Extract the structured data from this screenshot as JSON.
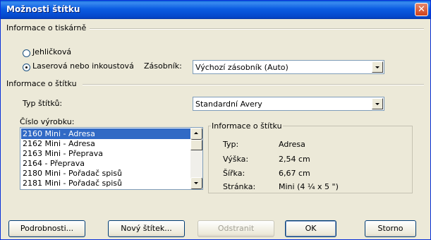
{
  "window": {
    "title": "Možnosti štítku",
    "close_icon": "close-icon"
  },
  "printer_group": {
    "label": "Informace o tiskárně",
    "radio_dotmatrix": "Jehličková",
    "radio_laser": "Laserová nebo inkoustová",
    "selected": "laser",
    "tray_label": "Zásobník:",
    "tray_value": "Výchozí zásobník (Auto)"
  },
  "label_group": {
    "label": "Informace o štítku",
    "type_label": "Typ štítků:",
    "type_value": "Standardní Avery",
    "product_label": "Číslo výrobku:",
    "products": [
      "2160 Mini - Adresa",
      "2162 Mini - Adresa",
      "2163 Mini - Přeprava",
      "2164 - Přeprava",
      "2180 Mini - Pořadač spisů",
      "2181 Mini - Pořadač spisů"
    ],
    "selected_index": 0
  },
  "info": {
    "title": "Informace o štítku",
    "rows": [
      {
        "label": "Typ:",
        "value": "Adresa"
      },
      {
        "label": "Výška:",
        "value": "2,54 cm"
      },
      {
        "label": "Šířka:",
        "value": "6,67 cm"
      },
      {
        "label": "Stránka:",
        "value": "Mini (4 ¼ x 5 \")"
      }
    ]
  },
  "buttons": {
    "details": "Podrobnosti...",
    "new_label": "Nový štítek...",
    "delete": "Odstranit",
    "ok": "OK",
    "cancel": "Storno"
  }
}
